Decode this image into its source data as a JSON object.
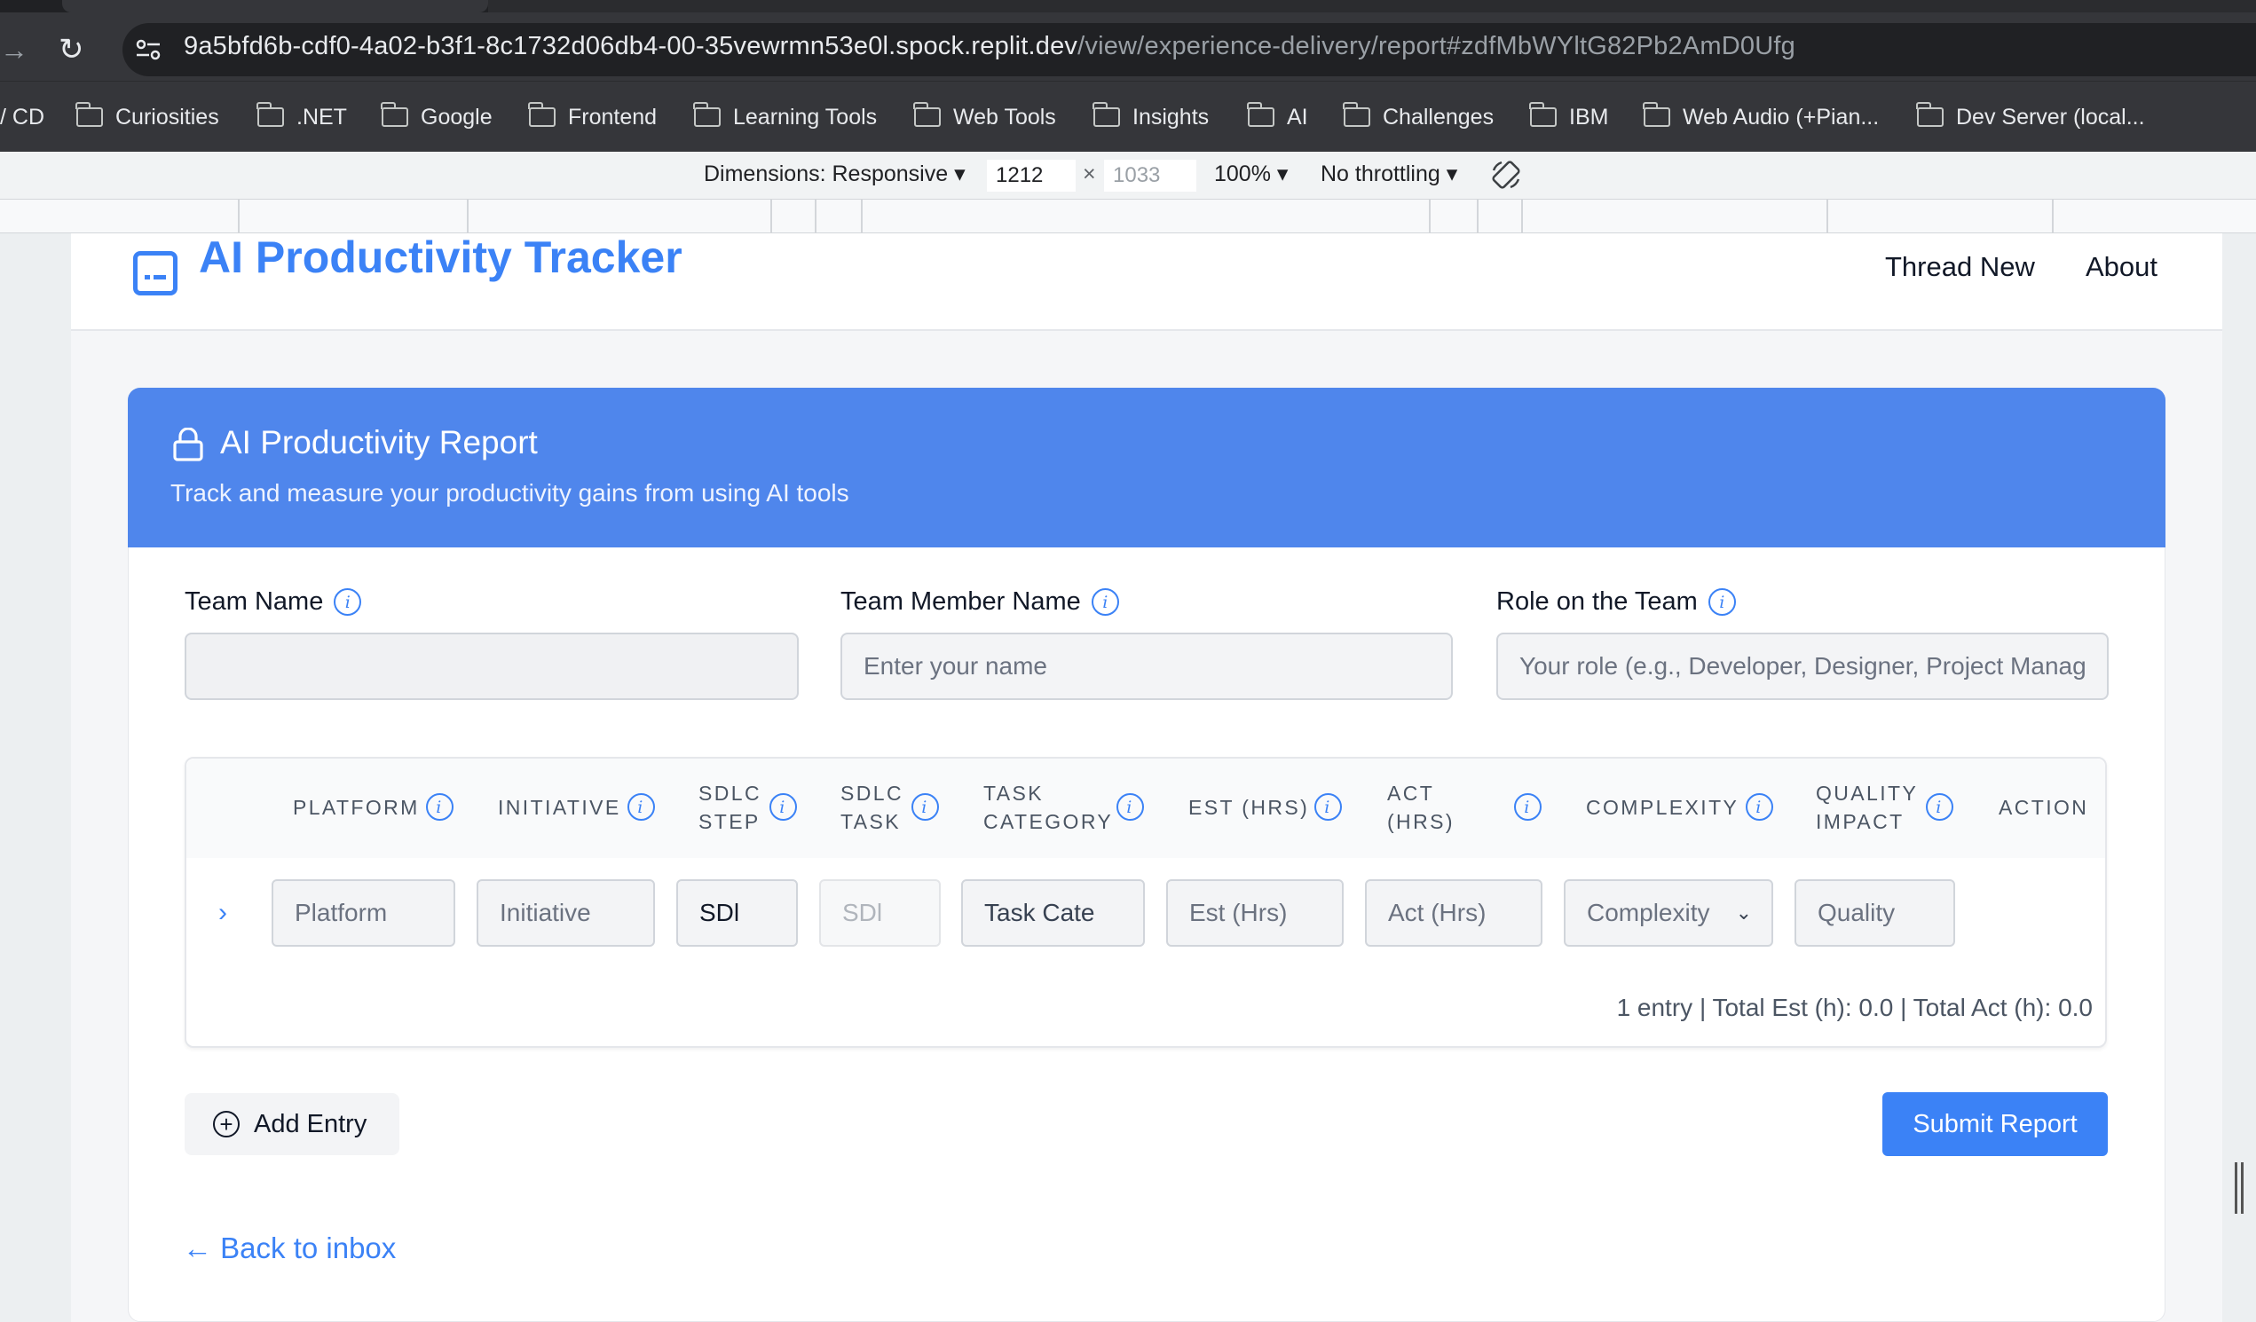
{
  "browser": {
    "url_host": "9a5bfd6b-cdf0-4a02-b3f1-8c1732d06db4-00-35vewrmn53e0l.spock.replit.dev",
    "url_path": "/view/experience-delivery/report#zdfMbWYltG82Pb2AmD0Ufg",
    "bookmarks": [
      "/ CD",
      "Curiosities",
      ".NET",
      "Google",
      "Frontend",
      "Learning Tools",
      "Web Tools",
      "Insights",
      "AI",
      "Challenges",
      "IBM",
      "Web Audio (+Pian...",
      "Dev Server (local..."
    ]
  },
  "devtools": {
    "dimensions_label": "Dimensions: Responsive",
    "width": "1212",
    "height": "1033",
    "zoom": "100%",
    "throttling": "No throttling",
    "times": "×"
  },
  "header": {
    "app_title": "AI Productivity Tracker",
    "nav": [
      "Thread New",
      "About"
    ]
  },
  "card": {
    "title": "AI Productivity Report",
    "subtitle": "Track and measure your productivity gains from using AI tools"
  },
  "form": {
    "team_name_label": "Team Name",
    "team_name_value": "",
    "member_label": "Team Member Name",
    "member_placeholder": "Enter your name",
    "role_label": "Role on the Team",
    "role_placeholder": "Your role (e.g., Developer, Designer, Project Manag"
  },
  "table": {
    "headers": [
      [
        "PLATFORM"
      ],
      [
        "INITIATIVE"
      ],
      [
        "SDLC",
        "STEP"
      ],
      [
        "SDLC",
        "TASK"
      ],
      [
        "TASK",
        "CATEGORY"
      ],
      [
        "EST (HRS)"
      ],
      [
        "ACT",
        "(HRS)"
      ],
      [
        "COMPLEXITY"
      ],
      [
        "QUALITY",
        "IMPACT"
      ],
      [
        "ACTION"
      ]
    ],
    "row_placeholders": [
      "Platform",
      "Initiative",
      "SDl",
      "SDl",
      "Task Cate",
      "Est (Hrs)",
      "Act (Hrs)",
      "Complexity",
      "Quality"
    ],
    "totals": "1 entry | Total Est (h): 0.0 | Total Act (h): 0.0"
  },
  "actions": {
    "add_entry": "Add Entry",
    "submit": "Submit Report",
    "back": "← Back to inbox"
  },
  "colors": {
    "accent": "#3b82f6",
    "header_bg": "#4f86ec"
  }
}
